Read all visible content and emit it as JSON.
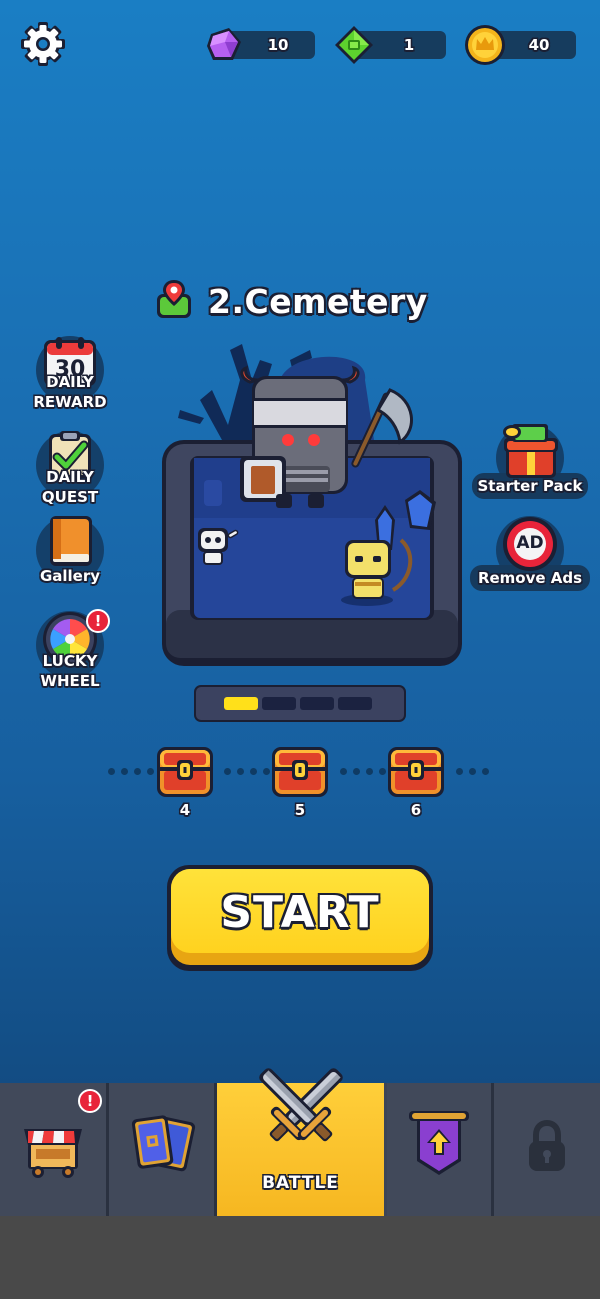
{
  "currencies": {
    "gems": "10",
    "emeralds": "1",
    "crowns": "40"
  },
  "level": {
    "title": "2.Cemetery",
    "progress_filled": 1,
    "progress_total": 4
  },
  "side_left": {
    "daily_reward_day": "30",
    "daily_reward_label1": "DAILY",
    "daily_reward_label2": "REWARD",
    "daily_quest_label1": "DAILY",
    "daily_quest_label2": "QUEST",
    "gallery_label": "Gallery",
    "lucky_wheel_label1": "LUCKY",
    "lucky_wheel_label2": "WHEEL",
    "alert": "!"
  },
  "side_right": {
    "starter_pack_label": "Starter Pack",
    "remove_ads_label": "Remove Ads",
    "ad_text": "AD"
  },
  "chests": [
    "4",
    "5",
    "6"
  ],
  "start_button": "START",
  "nav": {
    "battle_label": "BATTLE",
    "shop_alert": "!"
  },
  "icons": [
    "gear-icon",
    "gem-icon",
    "emerald-icon",
    "crown-coin-icon",
    "map-pin-icon",
    "calendar-icon",
    "checklist-icon",
    "book-icon",
    "color-wheel-icon",
    "gift-icon",
    "no-ad-icon",
    "chest-icon",
    "shop-stall-icon",
    "cards-icon",
    "crossed-swords-icon",
    "upgrade-banner-icon",
    "lock-icon"
  ],
  "colors": {
    "start_yellow": "#ffd21f",
    "nav_active": "#f6b721",
    "alert_red": "#e8243a"
  }
}
